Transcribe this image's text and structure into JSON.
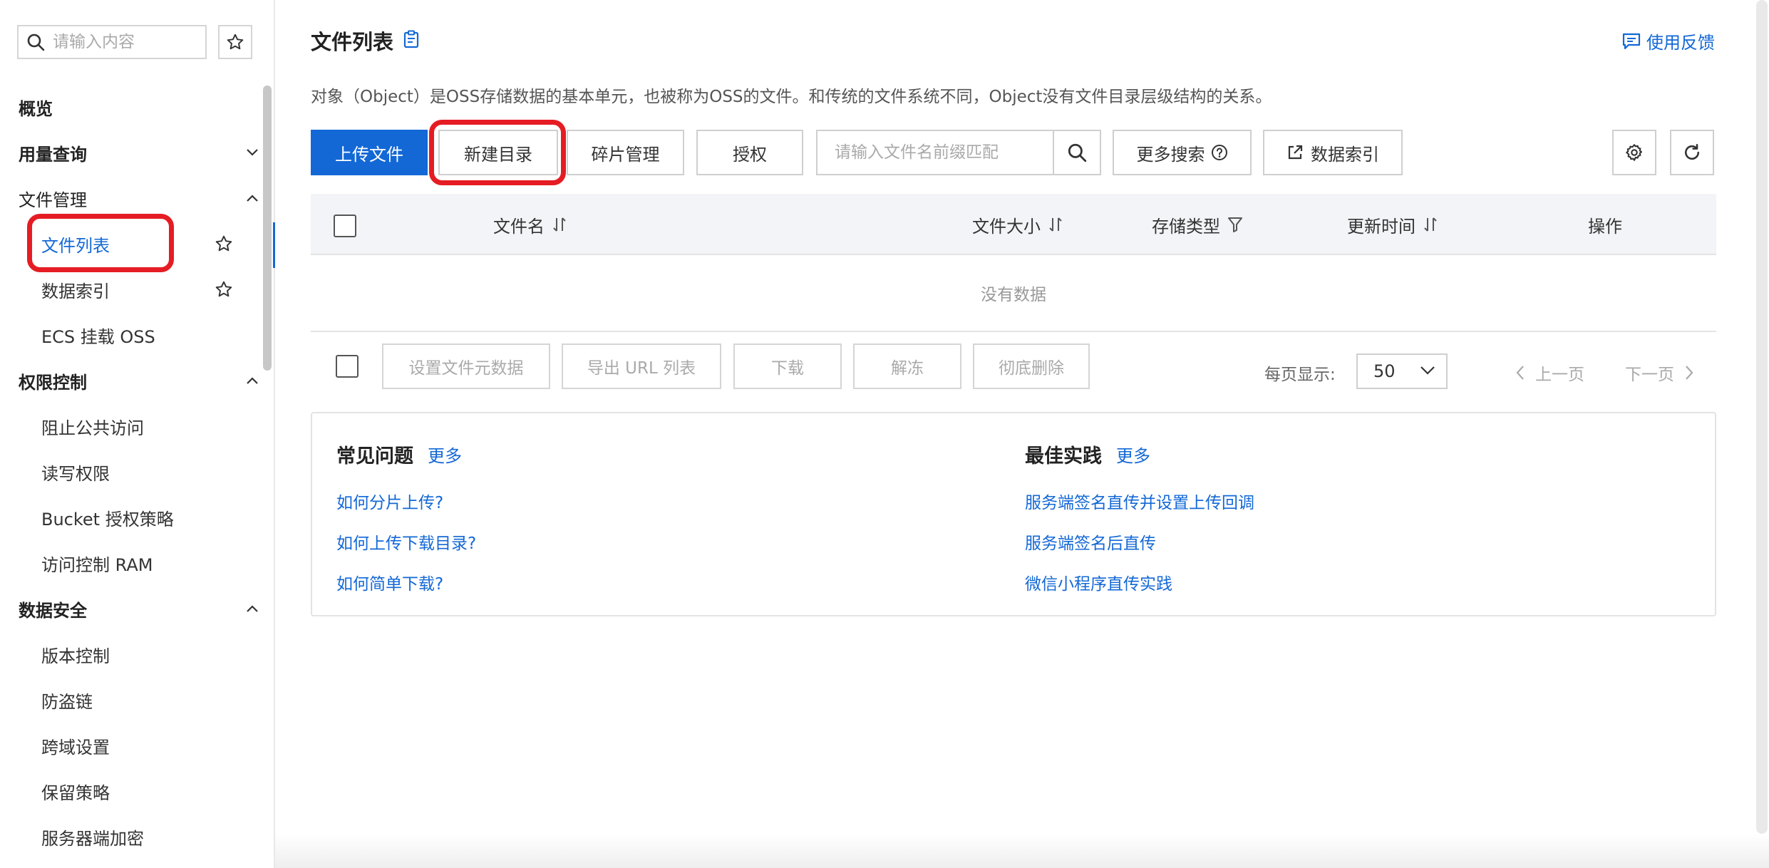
{
  "sidebar": {
    "search_placeholder": "请输入内容",
    "items": [
      {
        "label": "概览"
      },
      {
        "label": "用量查询"
      },
      {
        "label": "文件管理"
      },
      {
        "label": "文件列表"
      },
      {
        "label": "数据索引"
      },
      {
        "label": "ECS 挂载 OSS"
      },
      {
        "label": "权限控制"
      },
      {
        "label": "阻止公共访问"
      },
      {
        "label": "读写权限"
      },
      {
        "label": "Bucket 授权策略"
      },
      {
        "label": "访问控制 RAM"
      },
      {
        "label": "数据安全"
      },
      {
        "label": "版本控制"
      },
      {
        "label": "防盗链"
      },
      {
        "label": "跨域设置"
      },
      {
        "label": "保留策略"
      },
      {
        "label": "服务器端加密"
      }
    ]
  },
  "header": {
    "title": "文件列表",
    "feedback": "使用反馈",
    "description": "对象（Object）是OSS存储数据的基本单元，也被称为OSS的文件。和传统的文件系统不同，Object没有文件目录层级结构的关系。"
  },
  "toolbar": {
    "upload": "上传文件",
    "new_dir": "新建目录",
    "fragments": "碎片管理",
    "authorize": "授权",
    "search_placeholder": "请输入文件名前缀匹配",
    "more_search": "更多搜索",
    "data_index": "数据索引"
  },
  "table": {
    "columns": [
      "文件名",
      "文件大小",
      "存储类型",
      "更新时间",
      "操作"
    ],
    "empty": "没有数据"
  },
  "batch": {
    "set_meta": "设置文件元数据",
    "export_url": "导出 URL 列表",
    "download": "下载",
    "unfreeze": "解冻",
    "delete": "彻底删除"
  },
  "pagination": {
    "per_page_label": "每页显示:",
    "per_page_value": "50",
    "prev": "上一页",
    "next": "下一页"
  },
  "faq": {
    "title": "常见问题",
    "more": "更多",
    "links": [
      "如何分片上传?",
      "如何上传下载目录?",
      "如何简单下载?"
    ]
  },
  "best": {
    "title": "最佳实践",
    "more": "更多",
    "links": [
      "服务端签名直传并设置上传回调",
      "服务端签名后直传",
      "微信小程序直传实践"
    ]
  },
  "colors": {
    "accent": "#1368d6",
    "highlight": "#e51c23"
  }
}
